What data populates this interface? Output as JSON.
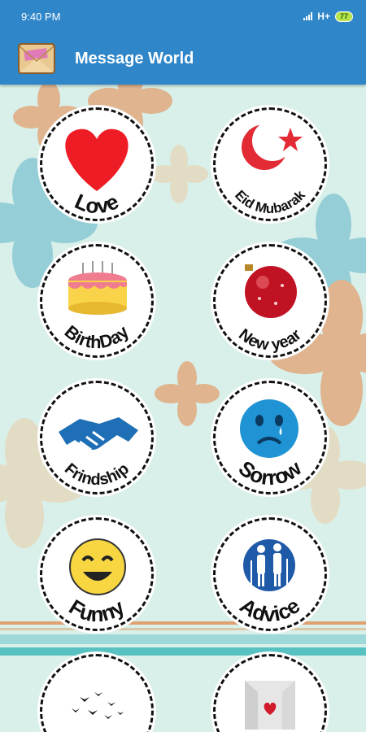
{
  "status_bar": {
    "time": "9:40 PM",
    "network": "H+",
    "battery": "77"
  },
  "app_bar": {
    "title": "Message World"
  },
  "categories": [
    {
      "label": "Love"
    },
    {
      "label": "Eid Mubarak"
    },
    {
      "label": "BirthDay"
    },
    {
      "label": "New year"
    },
    {
      "label": "Frindship"
    },
    {
      "label": "Sorrow"
    },
    {
      "label": "Funny"
    },
    {
      "label": "Advice"
    },
    {
      "label": ""
    },
    {
      "label": ""
    }
  ],
  "colors": {
    "primary": "#2f86c9",
    "background": "#d9f0ea"
  }
}
